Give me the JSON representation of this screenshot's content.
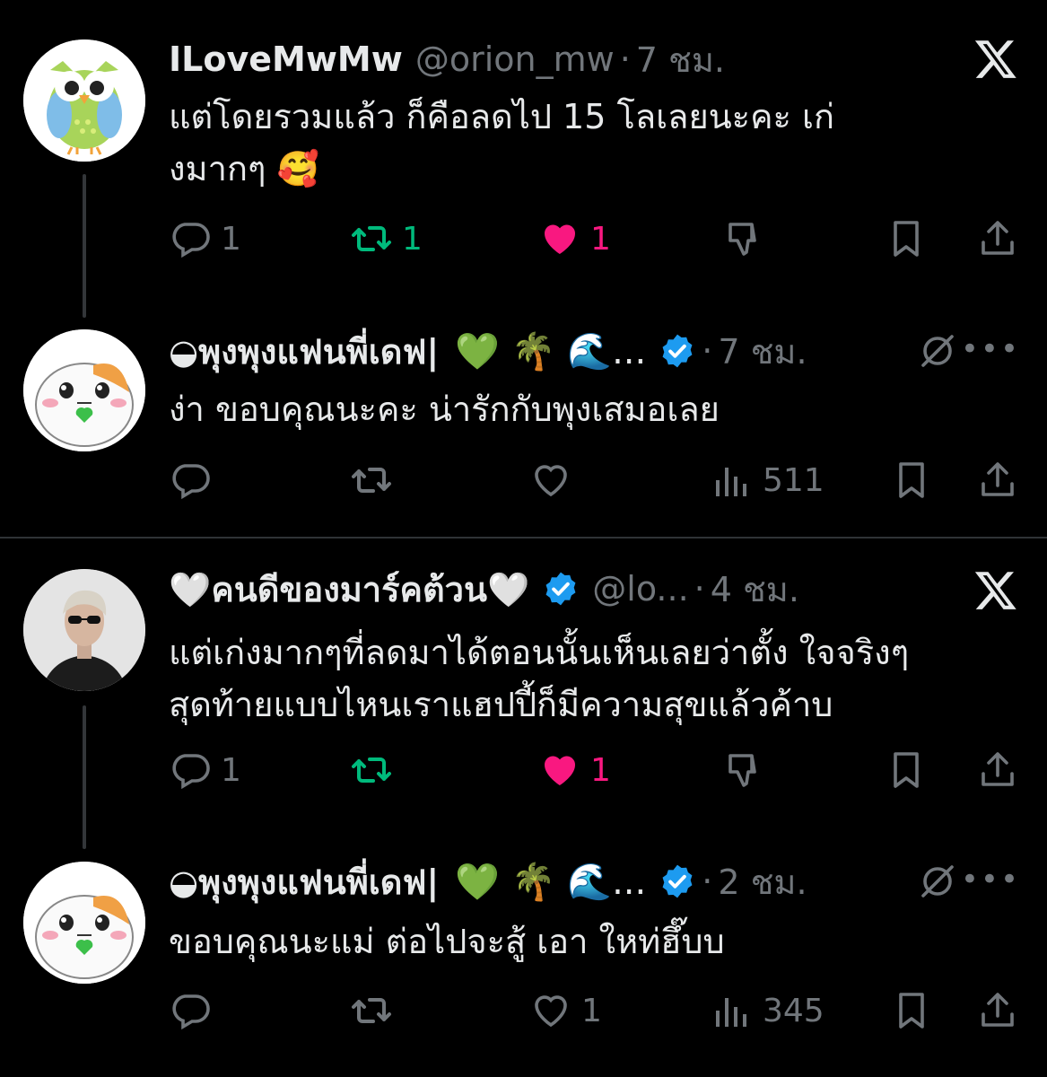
{
  "tweet1": {
    "name": "ILoveMwMw",
    "handle": "@orion_mw",
    "time": "7 ชม.",
    "text_line1": "แต่โดยรวมแล้ว ก็คือลดไป 15 โลเลยนะคะ เก่",
    "text_line2": "งมากๆ 🥰",
    "reply_count": "1",
    "retweet_count": "1",
    "like_count": "1",
    "liked": true,
    "retweeted": true,
    "avatar_icon": "owl-icon",
    "colors": {
      "like": "#f91880",
      "retweet": "#00ba7c",
      "icon": "#71767b"
    }
  },
  "tweet2": {
    "name": "◒พุงพุงแฟนพี่เดฟ|",
    "emojis": "💚 🌴 🌊...",
    "time": "7 ชม.",
    "text": "ง่า  ขอบคุณนะคะ  น่ารักกับพุงเสมอเลย",
    "views": "511",
    "avatar_icon": "hamster-icon"
  },
  "tweet3": {
    "name": "🤍คนดีของมาร์คต้วน🤍",
    "handle": "@lo...",
    "time": "4 ชม.",
    "text_line1": "แต่เก่งมากๆที่ลดมาได้ตอนนั้นเห็นเลยว่าตั้ง ใจจริงๆ",
    "text_line2": "สุดท้ายแบบไหนเราแฮปปี้ก็มีความสุขแล้วค้าบ",
    "reply_count": "1",
    "like_count": "1",
    "avatar_icon": "person-photo"
  },
  "tweet4": {
    "name": "◒พุงพุงแฟนพี่เดฟ|",
    "emojis": "💚 🌴 🌊...",
    "time": "2 ชม.",
    "text": "ขอบคุณนะแม่  ต่อไปจะสู้ เอา ใหท่ฮึ๊บบ",
    "like_count": "1",
    "views": "345",
    "avatar_icon": "hamster-icon"
  },
  "more_label": "•••"
}
